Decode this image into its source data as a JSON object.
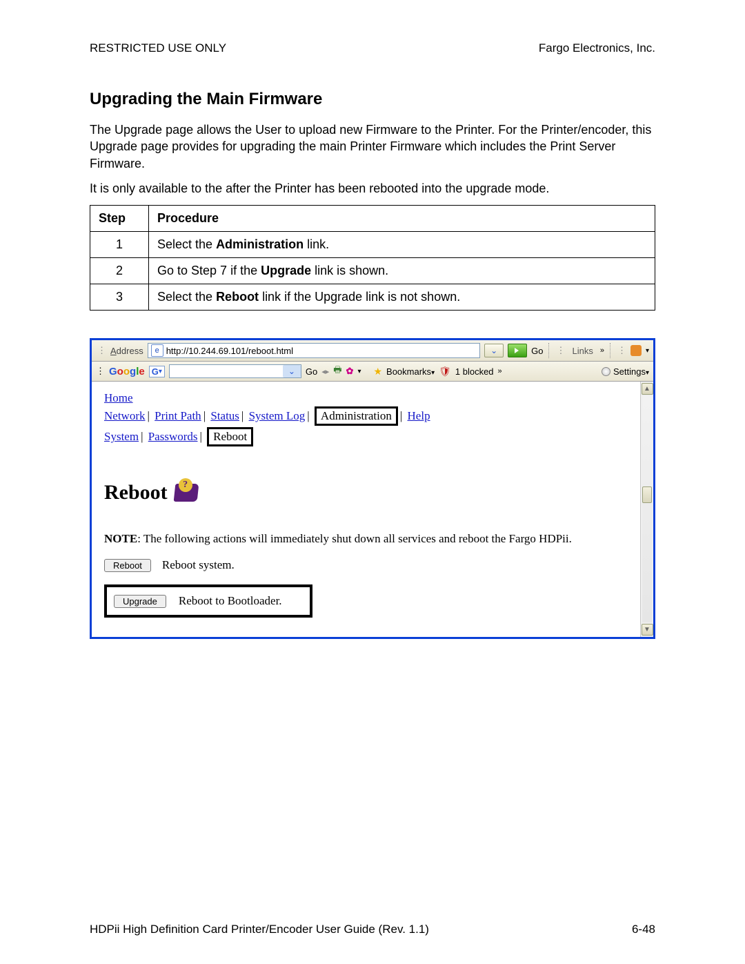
{
  "header": {
    "left": "RESTRICTED USE ONLY",
    "right": "Fargo Electronics, Inc."
  },
  "title": "Upgrading the Main Firmware",
  "para1": "The Upgrade page allows the User to upload new Firmware to the Printer. For the Printer/encoder, this Upgrade page provides for upgrading the main Printer Firmware which includes the Print Server Firmware.",
  "para2": "It is only available to the after the Printer has been rebooted into the upgrade mode.",
  "table": {
    "head_step": "Step",
    "head_proc": "Procedure",
    "rows": [
      {
        "n": "1",
        "pre": "Select the ",
        "bold": "Administration",
        "post": " link."
      },
      {
        "n": "2",
        "pre": "Go to Step 7 if the ",
        "bold": "Upgrade",
        "post": " link is shown."
      },
      {
        "n": "3",
        "pre": "Select the ",
        "bold": "Reboot",
        "post": " link if the Upgrade link is not shown."
      }
    ]
  },
  "browser": {
    "address_label": "Address",
    "url": "http://10.244.69.101/reboot.html",
    "go": "Go",
    "links": "Links",
    "google": {
      "go": "Go",
      "bookmarks": "Bookmarks",
      "blocked": "1 blocked",
      "settings": "Settings"
    },
    "nav": {
      "home": "Home",
      "row1": [
        "Network",
        "Print Path",
        "Status",
        "System Log"
      ],
      "admin": "Administration",
      "help": "Help",
      "row2": [
        "System",
        "Passwords"
      ],
      "reboot": "Reboot"
    },
    "page": {
      "heading": "Reboot",
      "note_label": "NOTE",
      "note_text": ": The following actions will immediately shut down all services and reboot the Fargo HDPii.",
      "btn_reboot": "Reboot",
      "txt_reboot": "Reboot system.",
      "btn_upgrade": "Upgrade",
      "txt_upgrade": "Reboot to Bootloader."
    }
  },
  "footer": {
    "left": "HDPii High Definition Card Printer/Encoder User Guide (Rev. 1.1)",
    "right": "6-48"
  }
}
